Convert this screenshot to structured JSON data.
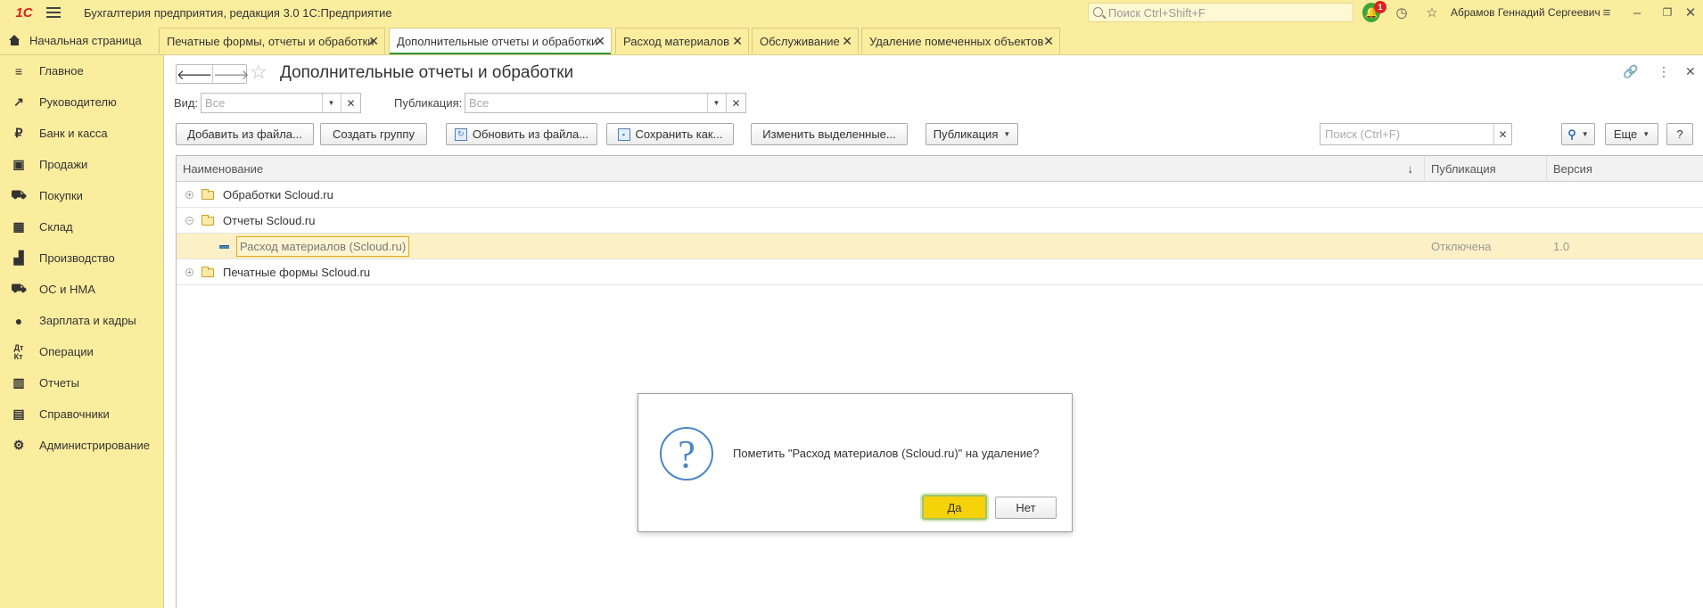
{
  "titlebar": {
    "logo": "1С",
    "app_title": "Бухгалтерия предприятия, редакция 3.0 1С:Предприятие",
    "search_placeholder": "Поиск Ctrl+Shift+F",
    "notifications_count": "1",
    "user_name": "Абрамов Геннадий Сергеевич"
  },
  "tabs": {
    "home": "Начальная страница",
    "items": [
      {
        "label": "Печатные формы, отчеты и обработки"
      },
      {
        "label": "Дополнительные отчеты и обработки"
      },
      {
        "label": "Расход материалов"
      },
      {
        "label": "Обслуживание"
      },
      {
        "label": "Удаление помеченных объектов"
      }
    ]
  },
  "sidebar": {
    "items": [
      {
        "label": "Главное",
        "icon": "menu-icon"
      },
      {
        "label": "Руководителю",
        "icon": "trend-icon"
      },
      {
        "label": "Банк и касса",
        "icon": "ruble-icon"
      },
      {
        "label": "Продажи",
        "icon": "bag-icon"
      },
      {
        "label": "Покупки",
        "icon": "cart-icon"
      },
      {
        "label": "Склад",
        "icon": "warehouse-icon"
      },
      {
        "label": "Производство",
        "icon": "factory-icon"
      },
      {
        "label": "ОС и НМА",
        "icon": "truck-icon"
      },
      {
        "label": "Зарплата и кадры",
        "icon": "person-icon"
      },
      {
        "label": "Операции",
        "icon": "dt-kt-icon"
      },
      {
        "label": "Отчеты",
        "icon": "bar-chart-icon"
      },
      {
        "label": "Справочники",
        "icon": "book-icon"
      },
      {
        "label": "Администрирование",
        "icon": "gear-icon"
      }
    ]
  },
  "page": {
    "title": "Дополнительные отчеты и обработки",
    "filters": {
      "kind_label": "Вид:",
      "kind_placeholder": "Все",
      "publication_label": "Публикация:",
      "publication_placeholder": "Все"
    },
    "toolbar": {
      "add_from_file": "Добавить из файла...",
      "create_group": "Создать группу",
      "update_from_file": "Обновить из файла...",
      "save_as": "Сохранить как...",
      "change_selected": "Изменить выделенные...",
      "publication": "Публикация",
      "search_placeholder": "Поиск (Ctrl+F)",
      "more": "Еще",
      "help": "?"
    },
    "table": {
      "columns": [
        "Наименование",
        "Публикация",
        "Версия"
      ],
      "sort_indicator": "↓",
      "rows": [
        {
          "name": "Обработки Scloud.ru",
          "publication": "",
          "version": ""
        },
        {
          "name": "Отчеты Scloud.ru",
          "publication": "",
          "version": ""
        },
        {
          "name": "Расход материалов (Scloud.ru)",
          "publication": "Отключена",
          "version": "1.0"
        },
        {
          "name": "Печатные формы Scloud.ru",
          "publication": "",
          "version": ""
        }
      ]
    }
  },
  "dialog": {
    "message": "Пометить \"Расход материалов (Scloud.ru)\" на удаление?",
    "yes": "Да",
    "no": "Нет"
  },
  "colors": {
    "panel": "#fbed9e",
    "accent_green": "#2e9b3a",
    "selection": "#fcf0c6",
    "primary_button": "#f6d20a"
  }
}
